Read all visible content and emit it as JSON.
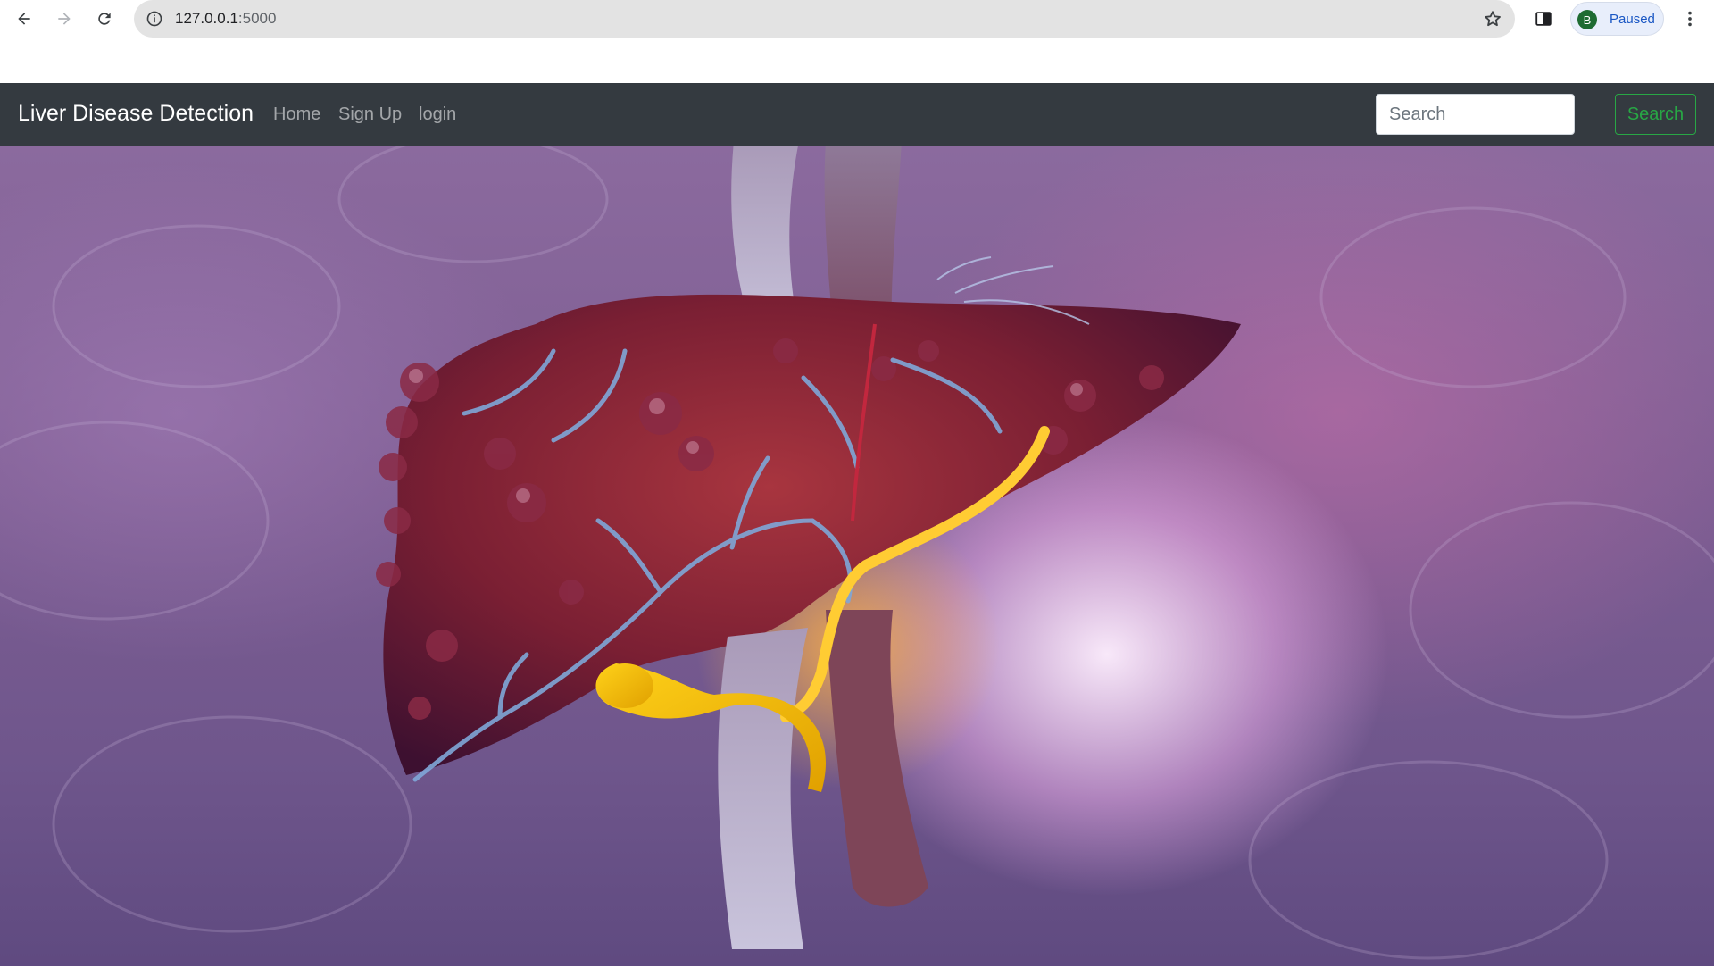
{
  "browser": {
    "url_host": "127.0.0.1",
    "url_port": ":5000",
    "profile_initial": "B",
    "profile_status": "Paused"
  },
  "navbar": {
    "brand": "Liver Disease Detection",
    "links": [
      "Home",
      "Sign Up",
      "login"
    ],
    "search_placeholder": "Search",
    "search_button": "Search"
  },
  "hero": {
    "image_subject": "3d-liver-illustration"
  },
  "colors": {
    "navbar_bg": "#343a40",
    "search_accent": "#28a745",
    "avatar_bg": "#1e6b32"
  }
}
